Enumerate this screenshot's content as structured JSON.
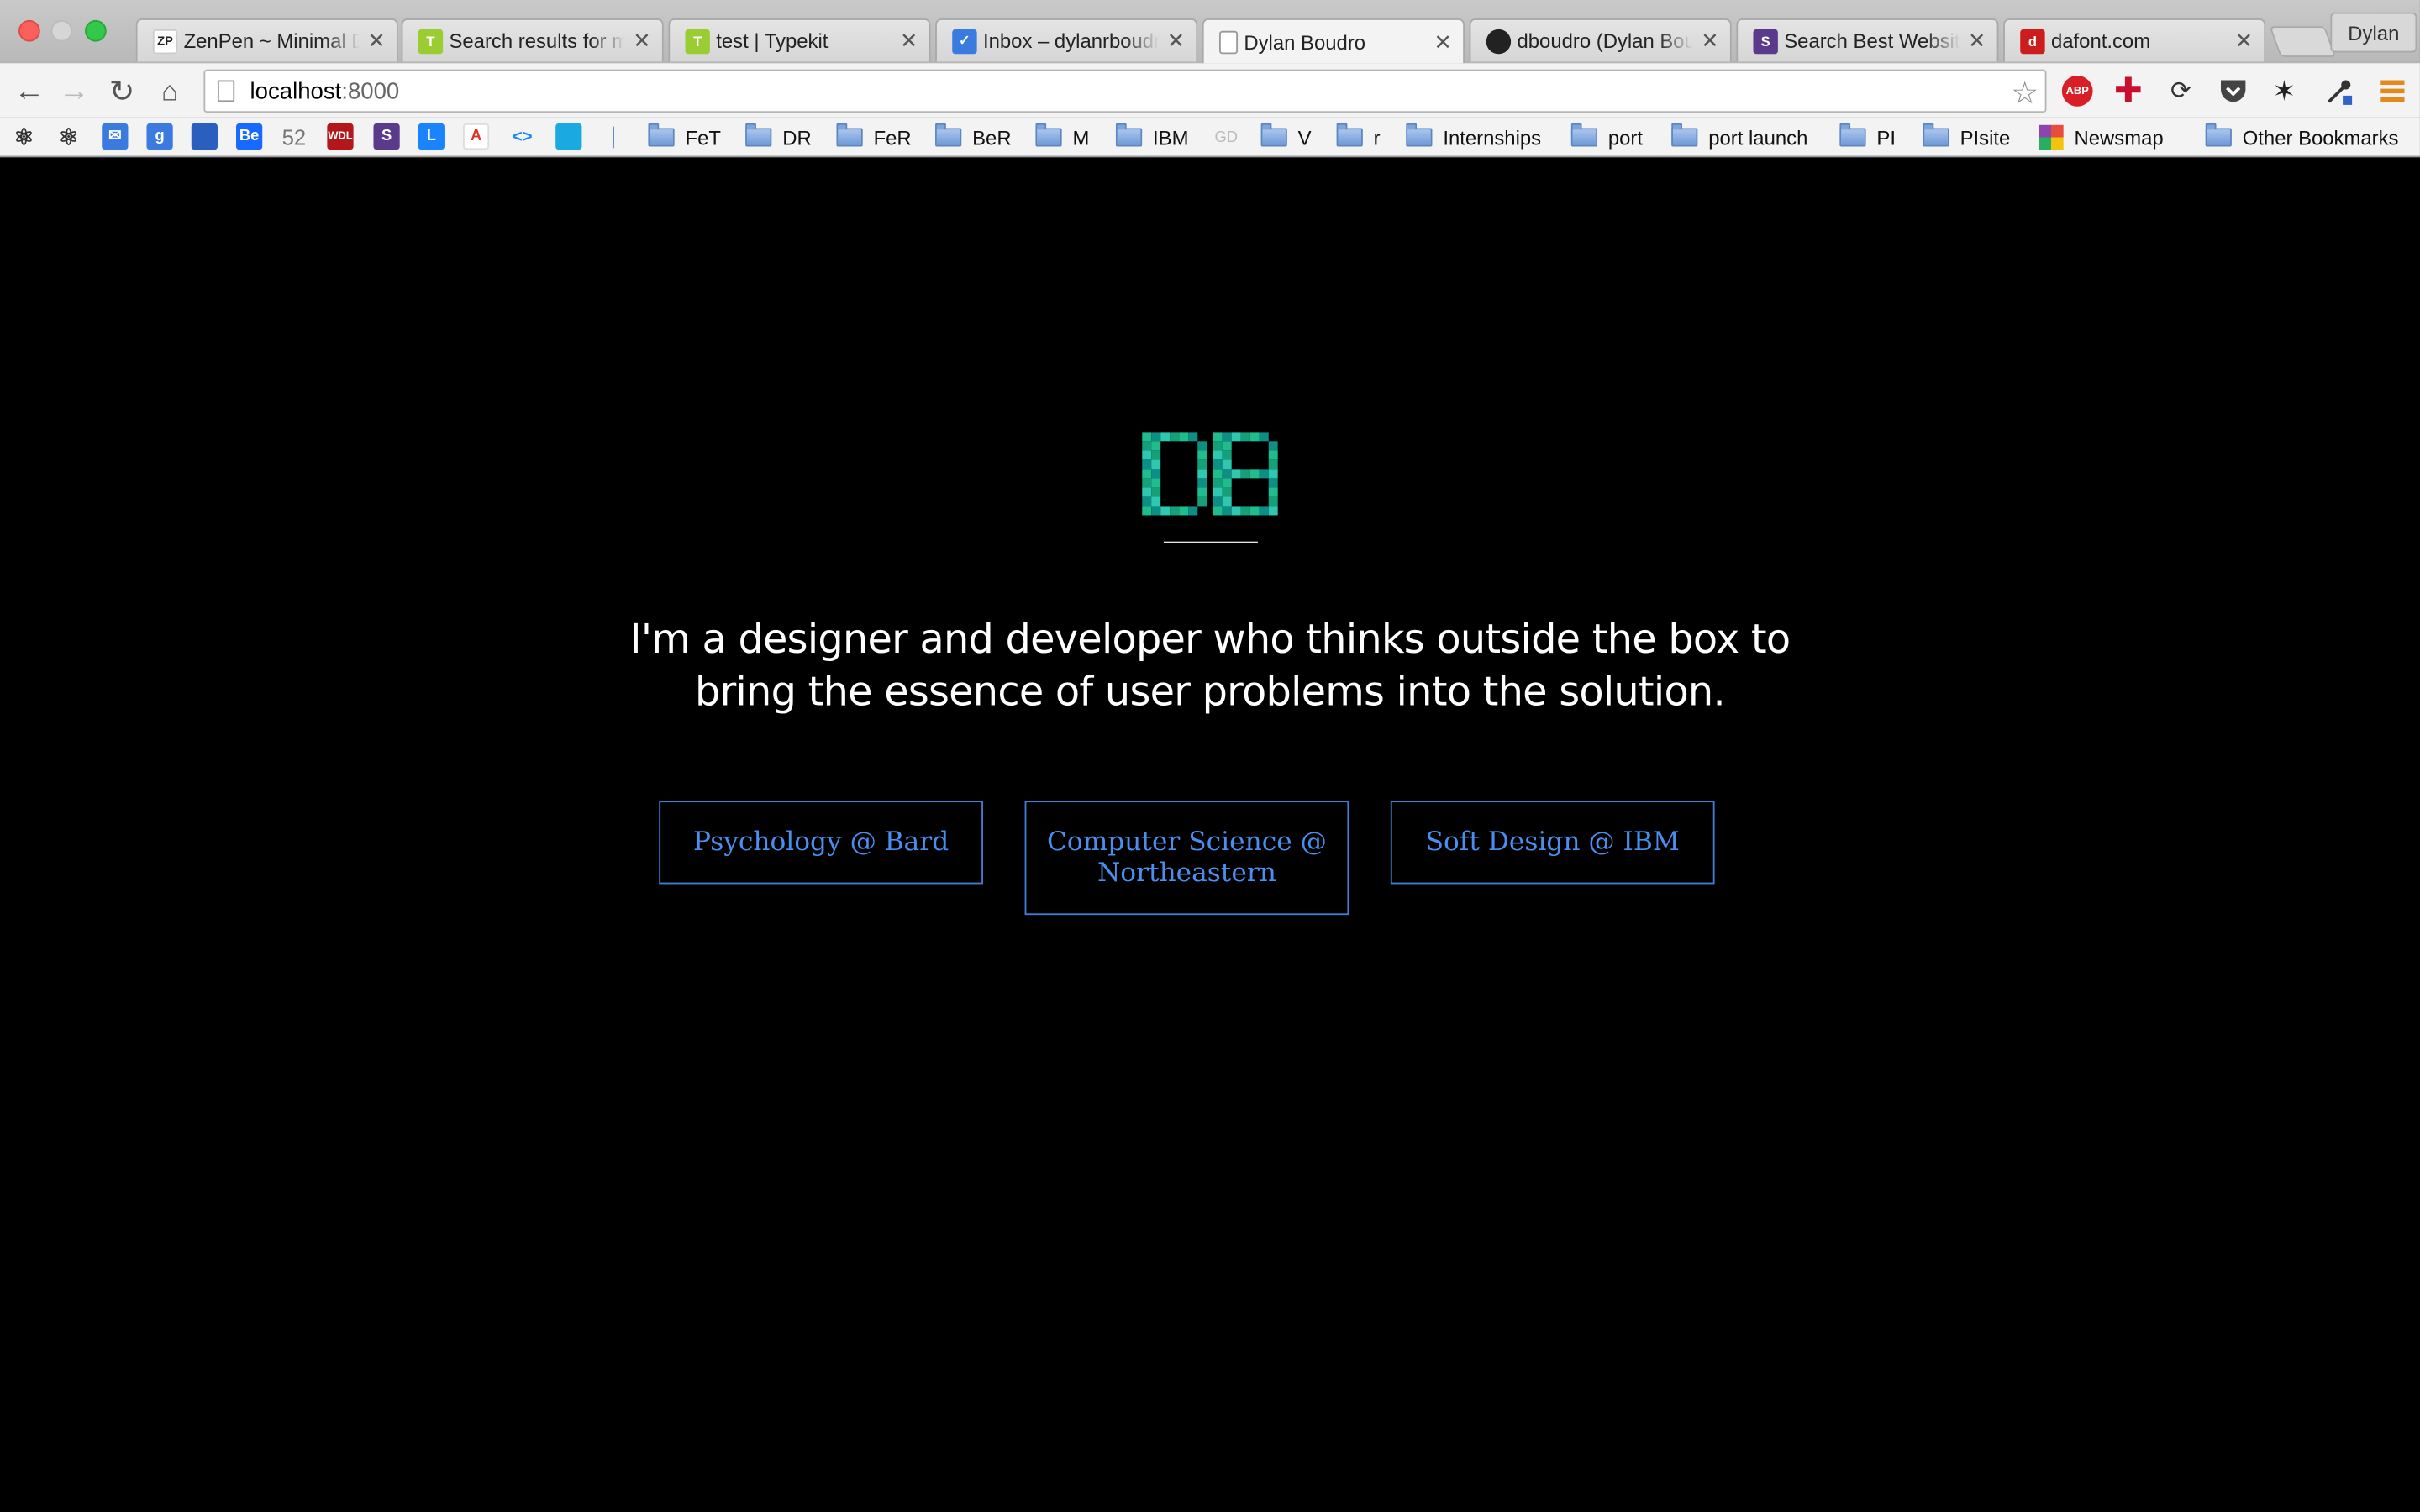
{
  "window": {
    "profile_name": "Dylan",
    "tabs": [
      {
        "title": "ZenPen ~ Minimal D",
        "favicon": "zenpen-icon",
        "favicon_text": "ZP",
        "active": false
      },
      {
        "title": "Search results for m",
        "favicon": "typekit-icon",
        "favicon_text": "T",
        "active": false
      },
      {
        "title": "test | Typekit",
        "favicon": "typekit-icon",
        "favicon_text": "T",
        "active": false
      },
      {
        "title": "Inbox – dylanrboudr",
        "favicon": "inbox-icon",
        "favicon_text": "",
        "active": false
      },
      {
        "title": "Dylan Boudro",
        "favicon": "page-icon",
        "favicon_text": "",
        "active": true
      },
      {
        "title": "dboudro (Dylan Bou",
        "favicon": "github-icon",
        "favicon_text": "",
        "active": false
      },
      {
        "title": "Search Best Website",
        "favicon": "slack-like-icon",
        "favicon_text": "",
        "active": false
      },
      {
        "title": "dafont.com",
        "favicon": "dafont-icon",
        "favicon_text": "",
        "active": false
      }
    ]
  },
  "toolbar": {
    "url_host": "localhost",
    "url_port": ":8000",
    "extensions": [
      "adblock-icon",
      "health-cross-icon",
      "sync-icon",
      "pocket-icon",
      "bird-icon",
      "eyedropper-icon",
      "menu-icon"
    ],
    "adblock_label": "ABP"
  },
  "bookmarks": {
    "icons": [
      {
        "name": "atom-icon-1",
        "text": "",
        "color": "#3a3a3a"
      },
      {
        "name": "atom-icon-2",
        "text": "",
        "color": "#3a3a3a"
      },
      {
        "name": "inbox-bookmark-icon",
        "text": "",
        "color": "#3b7be0"
      },
      {
        "name": "google-icon",
        "text": "g",
        "color": "#3b7be0"
      },
      {
        "name": "trello-icon",
        "text": "",
        "color": "#2a5fbf"
      },
      {
        "name": "behance-icon",
        "text": "Be",
        "color": "#1769ff"
      },
      {
        "name": "fiftytwo-icon",
        "text": "52",
        "color": "transparent"
      },
      {
        "name": "wdl-icon",
        "text": "WDL",
        "color": "#b3171b"
      },
      {
        "name": "s-icon",
        "text": "S",
        "color": "#5b3a8c"
      },
      {
        "name": "l-icon",
        "text": "L",
        "color": "#1a84ff"
      },
      {
        "name": "adobe-icon",
        "text": "A",
        "color": "#ffffff"
      },
      {
        "name": "code-icon",
        "text": "<>",
        "color": "transparent"
      },
      {
        "name": "tumblr-like-icon",
        "text": "",
        "color": "#1aa9e1"
      }
    ],
    "folders": [
      "FeT",
      "DR",
      "FeR",
      "BeR",
      "M",
      "IBM",
      "",
      "V",
      "r",
      "Internships",
      "port",
      "port launch",
      "PI",
      "PIsite"
    ],
    "newsmap": "Newsmap",
    "other": "Other Bookmarks"
  },
  "page": {
    "logo_text": "DB",
    "tagline": "I'm a designer and developer who thinks outside the box to bring the essence of user problems into the solution.",
    "buttons": [
      {
        "label": "Psychology @ Bard"
      },
      {
        "label": "Computer Science @ Northeastern"
      },
      {
        "label": "Soft Design @ IBM"
      }
    ],
    "accent_color": "#4a8ff0",
    "logo_colors": [
      "#1fbd8e",
      "#16a07a",
      "#2ec7b0",
      "#0e8f86"
    ]
  }
}
